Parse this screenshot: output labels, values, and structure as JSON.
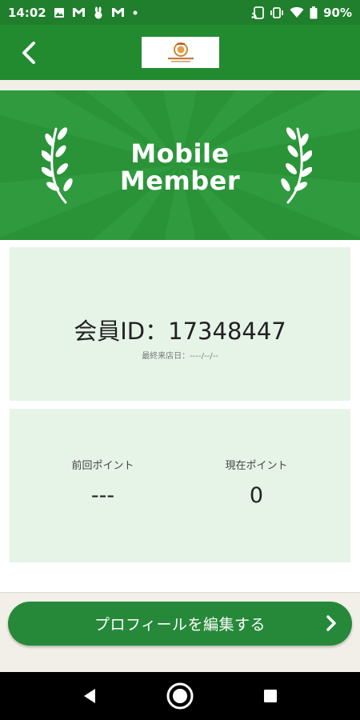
{
  "status_bar": {
    "time": "14:02",
    "battery": "90%",
    "icons": [
      "image-icon",
      "gmail-icon",
      "rabbit-icon",
      "gmail-icon",
      "dot-icon",
      "cast-icon",
      "vibrate-icon",
      "wifi-icon",
      "battery-icon"
    ]
  },
  "header": {
    "back_icon": "chevron-left-icon",
    "logo": "brand-logo"
  },
  "banner": {
    "line1": "Mobile",
    "line2": "Member",
    "decor": "laurel-icon"
  },
  "member": {
    "id_label": "会員ID：",
    "id_value": "17348447",
    "last_visit_label": "最終来店日：",
    "last_visit_value": "----/--/--"
  },
  "points": {
    "previous_label": "前回ポイント",
    "previous_value": "---",
    "current_label": "現在ポイント",
    "current_value": "0"
  },
  "actions": {
    "edit_profile_label": "プロフィールを編集する",
    "edit_profile_icon": "chevron-right-icon"
  },
  "nav": {
    "back": "nav-back-icon",
    "home": "nav-home-icon",
    "recents": "nav-recents-icon"
  },
  "colors": {
    "brand_green": "#228b30",
    "banner_green": "#2a9338",
    "card_bg": "#e6f4e8",
    "button_green": "#26893a"
  }
}
